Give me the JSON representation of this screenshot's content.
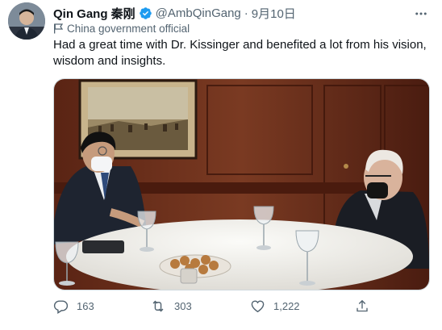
{
  "author": {
    "display_name": "Qin Gang 秦刚",
    "handle": "@AmbQinGang",
    "separator": "·",
    "date": "9月10日",
    "account_label": "China government official",
    "verified": true
  },
  "tweet": {
    "text_line_1": "Had a great time with Dr. Kissinger and benefited a lot from his vision,",
    "text_line_2": "wisdom and insights."
  },
  "media": {
    "alt": "photo"
  },
  "actions": {
    "replies": "163",
    "retweets": "303",
    "likes": "1,222"
  },
  "colors": {
    "verified_blue": "#1d9bf0",
    "secondary_text": "#536471",
    "primary_text": "#0f1419"
  }
}
